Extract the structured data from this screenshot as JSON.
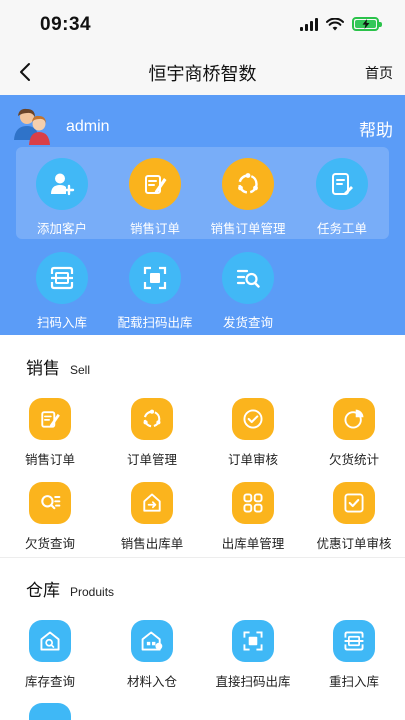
{
  "status_bar": {
    "time": "09:34"
  },
  "nav": {
    "title": "恒宇商桥智数",
    "home_label": "首页"
  },
  "user": {
    "name": "admin",
    "help_label": "帮助"
  },
  "quick_actions": [
    {
      "label": "添加客户",
      "icon": "add-customer-icon",
      "color": "#41b8f6"
    },
    {
      "label": "销售订单",
      "icon": "sales-order-icon",
      "color": "#fab31c"
    },
    {
      "label": "销售订单管理",
      "icon": "order-management-icon",
      "color": "#fab31c"
    },
    {
      "label": "任务工单",
      "icon": "task-order-icon",
      "color": "#41b8f6"
    },
    {
      "label": "扫码入库",
      "icon": "scan-icon",
      "color": "#41b8f6"
    },
    {
      "label": "配载扫码出库",
      "icon": "scan-frame-icon",
      "color": "#41b8f6"
    },
    {
      "label": "发货查询",
      "icon": "search-list-icon",
      "color": "#41b8f6"
    }
  ],
  "sections": [
    {
      "title": "销售",
      "subtitle": "Sell",
      "items": [
        {
          "label": "销售订单",
          "icon": "sales-order-icon"
        },
        {
          "label": "订单管理",
          "icon": "order-management-icon"
        },
        {
          "label": "订单审核",
          "icon": "check-circle-icon"
        },
        {
          "label": "欠货统计",
          "icon": "pie-chart-icon"
        },
        {
          "label": "欠货查询",
          "icon": "search-list-icon"
        },
        {
          "label": "销售出库单",
          "icon": "home-export-icon"
        },
        {
          "label": "出库单管理",
          "icon": "grid-icon"
        },
        {
          "label": "优惠订单审核",
          "icon": "checkbox-icon"
        }
      ]
    },
    {
      "title": "仓库",
      "subtitle": "Produits",
      "items": [
        {
          "label": "库存查询",
          "icon": "warehouse-search-icon"
        },
        {
          "label": "材料入仓",
          "icon": "warehouse-in-icon"
        },
        {
          "label": "直接扫码出库",
          "icon": "scan-frame-icon"
        },
        {
          "label": "重扫入库",
          "icon": "scan-icon"
        }
      ]
    }
  ],
  "colors": {
    "primary_blue": "#5b9cf7",
    "accent_yellow": "#fbb41d",
    "accent_blue": "#3fb8f6"
  }
}
